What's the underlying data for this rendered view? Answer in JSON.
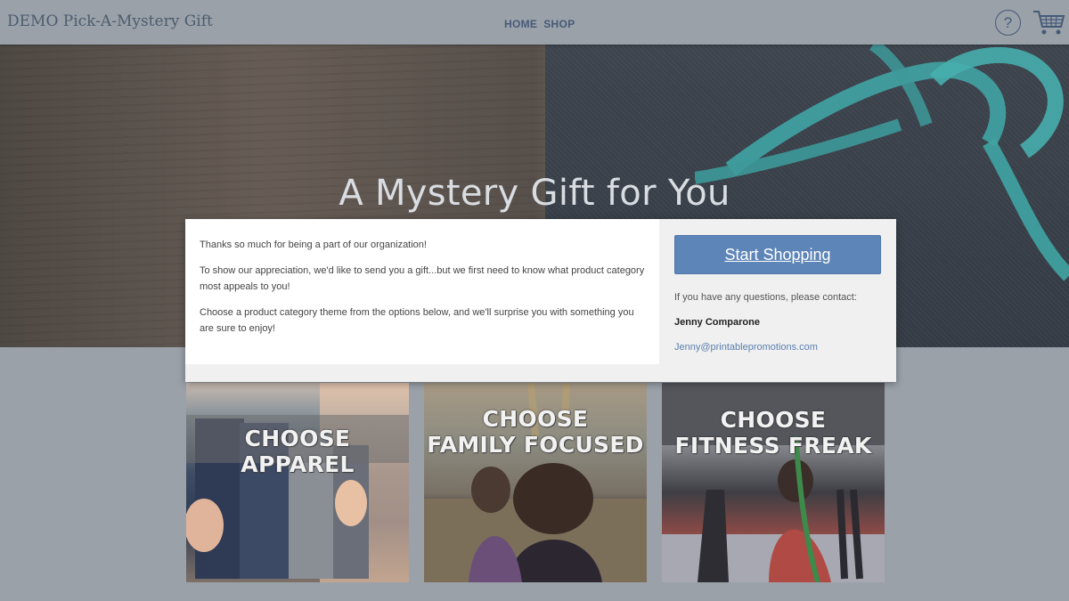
{
  "header": {
    "brand": "DEMO Pick-A-Mystery Gift",
    "nav": [
      "HOME",
      "SHOP"
    ],
    "help_icon": "?",
    "icons": [
      "help-icon",
      "cart-icon"
    ]
  },
  "hero": {
    "title": "A Mystery Gift for You"
  },
  "intro": {
    "p1": "Thanks so much for being a part of our organization!",
    "p2": "To show our appreciation, we'd like to send you a gift...but we first need to know what product category most appeals to you!",
    "p3": "Choose a product category theme from the options below, and we'll surprise you with something you are sure to enjoy!"
  },
  "sidebar": {
    "cta": "Start Shopping",
    "contact_label": "If you have any questions, please contact:",
    "contact_name": "Jenny Comparone",
    "contact_email": "Jenny@printablepromotions.com"
  },
  "categories": [
    {
      "line1": "CHOOSE APPAREL",
      "line2": ""
    },
    {
      "line1": "CHOOSE",
      "line2": "FAMILY FOCUSED"
    },
    {
      "line1": "CHOOSE",
      "line2": "FITNESS FREAK"
    }
  ],
  "colors": {
    "accent": "#5e85b8",
    "nav": "#465a78",
    "background": "#9aa1a9",
    "ribbon": "#2fa5a3"
  }
}
